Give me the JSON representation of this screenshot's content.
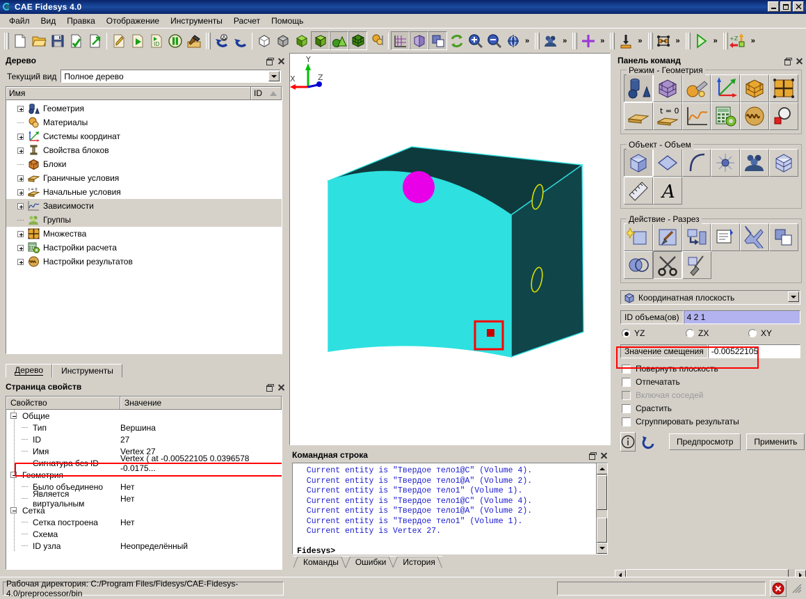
{
  "window": {
    "title": "CAE Fidesys 4.0",
    "icon": "fidesys-logo-icon",
    "buttons": {
      "minimize": "_",
      "maximize": "□",
      "close": "×"
    }
  },
  "menu": {
    "items": [
      "Файл",
      "Вид",
      "Правка",
      "Отображение",
      "Инструменты",
      "Расчет",
      "Помощь"
    ]
  },
  "toolbar": {
    "overflow_label": "»",
    "groups": [
      {
        "name": "file",
        "buttons": [
          {
            "icon": "new-file-icon",
            "checked": false
          },
          {
            "icon": "open-folder-icon",
            "checked": false
          },
          {
            "icon": "save-disk-icon",
            "checked": false
          },
          {
            "icon": "import-file-icon",
            "checked": false
          },
          {
            "icon": "export-file-icon",
            "checked": false
          }
        ]
      },
      {
        "name": "journal",
        "buttons": [
          {
            "icon": "edit-journal-icon",
            "checked": false
          },
          {
            "icon": "play-journal-icon",
            "checked": false
          },
          {
            "icon": "id-journal-icon",
            "checked": false
          },
          {
            "icon": "pause-icon",
            "checked": false
          },
          {
            "icon": "build-hammer-icon",
            "checked": false
          }
        ]
      },
      {
        "name": "undo",
        "buttons": [
          {
            "icon": "reset-icon",
            "checked": false
          },
          {
            "icon": "undo-arrow-icon",
            "checked": false
          }
        ]
      },
      {
        "name": "display-mode",
        "buttons": [
          {
            "icon": "wireframe-cube-icon",
            "checked": false
          },
          {
            "icon": "hidden-line-cube-icon",
            "checked": false
          },
          {
            "icon": "smooth-shade-cube-icon",
            "checked": false
          },
          {
            "icon": "flat-shade-cube-icon",
            "checked": true
          },
          {
            "icon": "geometry-primitives-icon",
            "checked": true
          },
          {
            "icon": "mesh-cube-icon",
            "checked": true
          },
          {
            "icon": "composite-icon",
            "checked": false
          }
        ]
      },
      {
        "name": "view",
        "buttons": [
          {
            "icon": "grid-axes-icon",
            "checked": true
          },
          {
            "icon": "clip-cube-icon",
            "checked": true
          },
          {
            "icon": "overlap-squares-icon",
            "checked": true
          },
          {
            "icon": "refresh-icon",
            "checked": false
          },
          {
            "icon": "zoom-in-icon",
            "checked": false
          },
          {
            "icon": "zoom-out-icon",
            "checked": false
          },
          {
            "icon": "zoom-fit-globe-icon",
            "checked": false
          }
        ]
      },
      {
        "name": "groups",
        "buttons": [
          {
            "icon": "group-people-icon",
            "checked": false
          }
        ]
      },
      {
        "name": "picking",
        "buttons": [
          {
            "icon": "crosshair-icon",
            "checked": false
          }
        ]
      },
      {
        "name": "mesh-ops",
        "buttons": [
          {
            "icon": "imprint-merge-icon",
            "checked": false
          }
        ]
      },
      {
        "name": "nodeset",
        "buttons": [
          {
            "icon": "nodeset-icon",
            "checked": false
          }
        ]
      },
      {
        "name": "run",
        "buttons": [
          {
            "icon": "run-play-icon",
            "checked": false
          }
        ]
      },
      {
        "name": "axis",
        "buttons": [
          {
            "icon": "z-axis-view-icon",
            "checked": false
          }
        ]
      }
    ]
  },
  "tree_panel": {
    "title": "Дерево",
    "view_label": "Текущий вид",
    "view_value": "Полное дерево",
    "columns": [
      "Имя",
      "ID"
    ],
    "items": [
      {
        "label": "Геометрия",
        "expandable": true,
        "icon": "geometry-icon",
        "selected": false
      },
      {
        "label": "Материалы",
        "expandable": false,
        "icon": "materials-icon",
        "selected": false
      },
      {
        "label": "Системы координат",
        "expandable": true,
        "icon": "coordsys-icon",
        "selected": false
      },
      {
        "label": "Свойства блоков",
        "expandable": true,
        "icon": "blockprops-icon",
        "selected": false
      },
      {
        "label": "Блоки",
        "expandable": false,
        "icon": "blocks-icon",
        "selected": false
      },
      {
        "label": "Граничные условия",
        "expandable": true,
        "icon": "bc-icon",
        "selected": false
      },
      {
        "label": "Начальные условия",
        "expandable": true,
        "icon": "ic-icon",
        "selected": false
      },
      {
        "label": "Зависимости",
        "expandable": true,
        "icon": "curves-icon",
        "selected": true
      },
      {
        "label": "Группы",
        "expandable": false,
        "icon": "groups-icon",
        "selected": true
      },
      {
        "label": "Множества",
        "expandable": true,
        "icon": "sets-icon",
        "selected": false
      },
      {
        "label": "Настройки расчета",
        "expandable": true,
        "icon": "calcsettings-icon",
        "selected": false
      },
      {
        "label": "Настройки результатов",
        "expandable": true,
        "icon": "results-icon",
        "selected": false
      }
    ],
    "tabs": [
      {
        "label": "Дерево",
        "active": true
      },
      {
        "label": "Инструменты",
        "active": false
      }
    ]
  },
  "properties_panel": {
    "title": "Страница свойств",
    "columns": [
      "Свойство",
      "Значение"
    ],
    "rows": [
      {
        "key": "Общие",
        "value": "",
        "level": 0,
        "group": true
      },
      {
        "key": "Тип",
        "value": "Вершина",
        "level": 1,
        "group": false
      },
      {
        "key": "ID",
        "value": "27",
        "level": 1,
        "group": false
      },
      {
        "key": "Имя",
        "value": "Vertex 27",
        "level": 1,
        "group": false
      },
      {
        "key": "Сигнатура без ID",
        "value": "Vertex ( at -0.00522105 0.0396578 -0.0175...",
        "level": 1,
        "group": false,
        "highlighted": true
      },
      {
        "key": "Геометрия",
        "value": "",
        "level": 0,
        "group": true
      },
      {
        "key": "Было объединено",
        "value": "Нет",
        "level": 1,
        "group": false
      },
      {
        "key": "Является виртуальным",
        "value": "Нет",
        "level": 1,
        "group": false
      },
      {
        "key": "Сетка",
        "value": "",
        "level": 0,
        "group": true
      },
      {
        "key": "Сетка построена",
        "value": "Нет",
        "level": 1,
        "group": false
      },
      {
        "key": "Схема",
        "value": "",
        "level": 1,
        "group": false
      },
      {
        "key": "ID узла",
        "value": "Неопределённый",
        "level": 1,
        "group": false
      }
    ]
  },
  "viewport": {
    "axis_labels": {
      "x": "X",
      "y": "Y",
      "z": "Z"
    },
    "axis_colors": {
      "x": "#ff0000",
      "y": "#00c000",
      "z": "#0000d0"
    },
    "model_colors": {
      "front_face": "#2ee0e0",
      "side_face": "#10454a",
      "top_face": "#0f3a3d",
      "edge": "#2ee0e0",
      "circle_marker": "#e800e8",
      "ellipse_outline": "#d8e000",
      "selection_box": "#ff0000"
    }
  },
  "command_line_panel": {
    "title": "Командная строка",
    "lines": [
      "Current entity is \"Твердое тело1@C\" (Volume 4).",
      "Current entity is \"Твердое тело1@A\" (Volume 2).",
      "Current entity is \"Твердое тело1\" (Volume 1).",
      "Current entity is \"Твердое тело1@C\" (Volume 4).",
      "Current entity is \"Твердое тело1@A\" (Volume 2).",
      "Current entity is \"Твердое тело1\" (Volume 1).",
      "Current entity is Vertex 27."
    ],
    "prompt": "Fidesys>",
    "tabs": [
      {
        "label": "Команды",
        "active": true
      },
      {
        "label": "Ошибки",
        "active": false
      },
      {
        "label": "История",
        "active": false
      }
    ]
  },
  "command_panel": {
    "title": "Панель команд",
    "groups": [
      {
        "legend": "Режим - Геометрия",
        "rows": [
          [
            {
              "icon": "geometry-mode-icon",
              "active": true
            },
            {
              "icon": "mesh-mode-icon",
              "active": false
            },
            {
              "icon": "tools-mode-icon",
              "active": false
            },
            {
              "icon": "coordsys-mode-icon",
              "active": false
            },
            {
              "icon": "blocks-mode-icon",
              "active": false
            },
            {
              "icon": "sets-mode-icon",
              "active": false
            }
          ],
          [
            {
              "icon": "boundary-conditions-icon",
              "active": false
            },
            {
              "icon": "initial-conditions-icon",
              "active": false
            },
            {
              "icon": "curve-plot-icon",
              "active": false
            },
            {
              "icon": "calc-settings-icon",
              "active": false
            },
            {
              "icon": "results-wave-icon",
              "active": false
            },
            {
              "icon": "inspect-icon",
              "active": false
            }
          ]
        ]
      },
      {
        "legend": "Объект - Объем",
        "rows": [
          [
            {
              "icon": "volume-icon",
              "active": true
            },
            {
              "icon": "surface-icon",
              "active": false
            },
            {
              "icon": "curve-icon",
              "active": false
            },
            {
              "icon": "vertex-icon",
              "active": false
            },
            {
              "icon": "group-icon",
              "active": false
            },
            {
              "icon": "body-icon",
              "active": false
            }
          ],
          [
            {
              "icon": "measure-ruler-icon",
              "active": false
            },
            {
              "icon": "text-label-icon",
              "active": false
            }
          ]
        ]
      },
      {
        "legend": "Действие - Разрез",
        "rows": [
          [
            {
              "icon": "create-icon",
              "active": false
            },
            {
              "icon": "modify-icon",
              "active": false
            },
            {
              "icon": "transform-icon",
              "active": false
            },
            {
              "icon": "properties-icon",
              "active": false
            },
            {
              "icon": "delete-x-icon",
              "active": false
            },
            {
              "icon": "copy-icon",
              "active": false
            }
          ],
          [
            {
              "icon": "boolean-icon",
              "active": false
            },
            {
              "icon": "webcut-scissors-icon",
              "active": true
            },
            {
              "icon": "cleanup-icon",
              "active": false
            }
          ]
        ]
      }
    ],
    "method_combo": {
      "icon": "cube-icon",
      "value": "Координатная плоскость"
    },
    "volume_field": {
      "label": "ID объема(ов)",
      "value": "4 2 1"
    },
    "plane_radios": [
      {
        "label": "YZ",
        "selected": true
      },
      {
        "label": "ZX",
        "selected": false
      },
      {
        "label": "XY",
        "selected": false
      }
    ],
    "offset_field": {
      "label": "Значение смещения",
      "value": "-0.00522105",
      "highlighted": true
    },
    "checkboxes": [
      {
        "label": "Повернуть плоскость",
        "checked": false,
        "disabled": false
      },
      {
        "label": "Отпечатать",
        "checked": false,
        "disabled": false
      },
      {
        "label": "Включая соседей",
        "checked": false,
        "disabled": true
      },
      {
        "label": "Срастить",
        "checked": false,
        "disabled": false
      },
      {
        "label": "Сгруппировать результаты",
        "checked": false,
        "disabled": false
      }
    ],
    "actions": {
      "info_icon": "info-icon",
      "reset_icon": "reset-arrow-icon",
      "preview": "Предпросмотр",
      "apply": "Применить"
    }
  },
  "status_bar": {
    "text": "Рабочая директория: C:/Program Files/Fidesys/CAE-Fidesys-4.0/preprocessor/bin",
    "stop_icon": "stop-error-icon"
  }
}
